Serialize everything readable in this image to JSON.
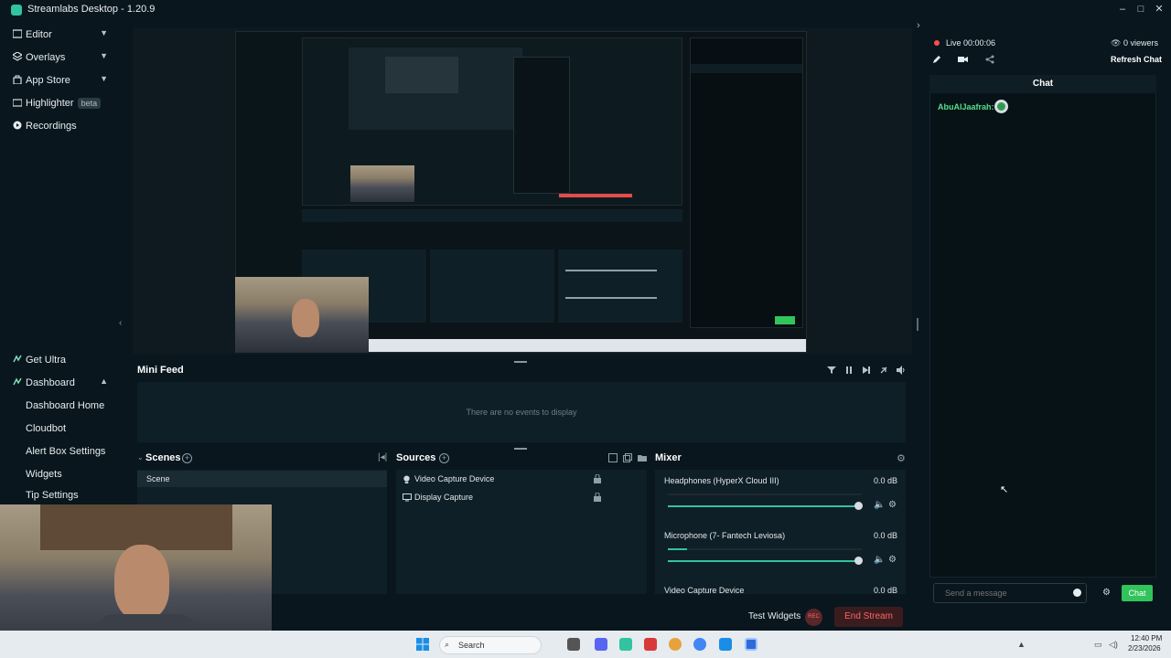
{
  "window": {
    "title": "Streamlabs Desktop - 1.20.9",
    "minimize": "–",
    "maximize": "□",
    "close": "✕"
  },
  "sidebar": {
    "items": [
      {
        "label": "Editor",
        "icon": "editor-icon"
      },
      {
        "label": "Overlays",
        "icon": "overlays-icon"
      },
      {
        "label": "App Store",
        "icon": "store-icon"
      },
      {
        "label": "Highlighter",
        "icon": "highlighter-icon",
        "badge": "beta"
      },
      {
        "label": "Recordings",
        "icon": "recordings-icon"
      }
    ],
    "bottom": {
      "get_ultra": "Get Ultra",
      "dashboard": "Dashboard",
      "sub": [
        "Dashboard Home",
        "Cloudbot",
        "Alert Box Settings",
        "Widgets",
        "Tip Settings"
      ]
    }
  },
  "mini_feed": {
    "title": "Mini Feed",
    "empty": "There are no events to display"
  },
  "scenes": {
    "title": "Scenes",
    "items": [
      "Scene"
    ]
  },
  "sources": {
    "title": "Sources",
    "items": [
      "Video Capture Device",
      "Display Capture"
    ]
  },
  "mixer": {
    "title": "Mixer",
    "channels": [
      {
        "name": "Headphones (HyperX Cloud III)",
        "db": "0.0 dB",
        "level": 0.95
      },
      {
        "name": "Microphone (7- Fantech Leviosa)",
        "db": "0.0 dB",
        "level": 0.95
      },
      {
        "name": "Video Capture Device",
        "db": "0.0 dB"
      }
    ]
  },
  "bottom_bar": {
    "test_widgets": "Test Widgets",
    "rec": "REC",
    "end_stream": "End Stream"
  },
  "live": {
    "status": "Live 00:00:06",
    "viewers": "0 viewers",
    "refresh": "Refresh Chat"
  },
  "chat": {
    "header": "Chat",
    "messages": [
      {
        "user": "AbuAlJaafrah:"
      }
    ],
    "placeholder": "Send a message",
    "send": "Chat"
  },
  "taskbar": {
    "search": "Search",
    "time": "12:40 PM",
    "date": "2/23/2026"
  },
  "colors": {
    "accent": "#31c3a2",
    "live_red": "#ff4d4d",
    "chat_green": "#32c35b"
  }
}
